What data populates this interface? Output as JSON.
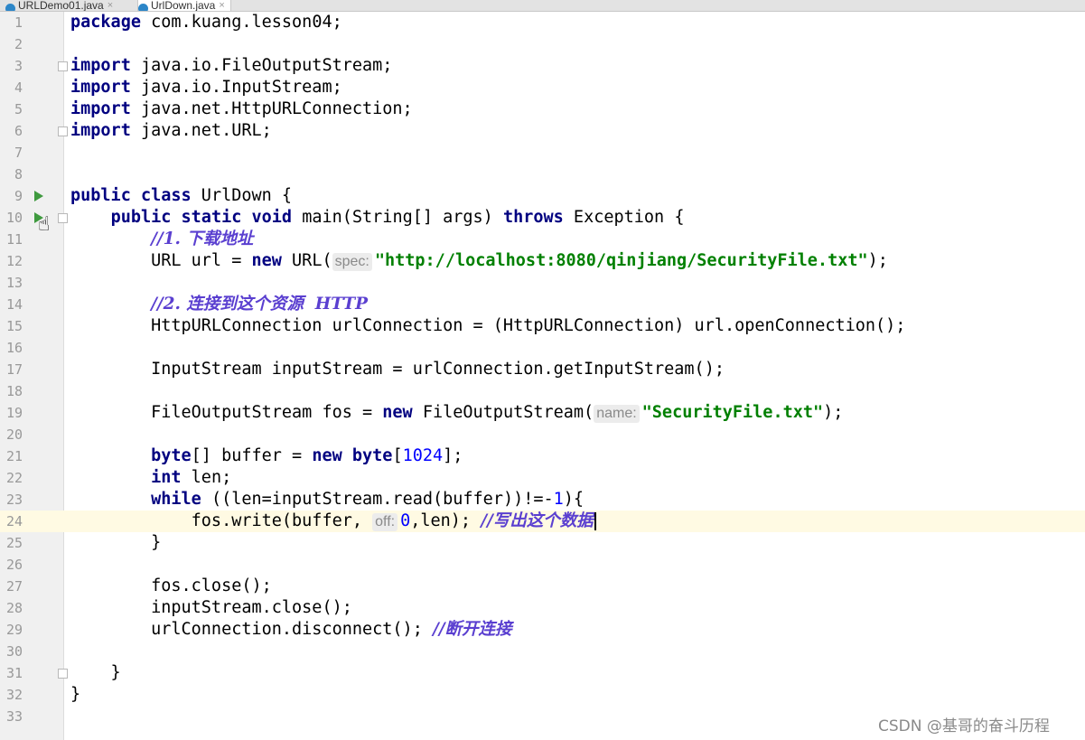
{
  "tabs": [
    {
      "label": "URLDemo01.java",
      "close": "×"
    },
    {
      "label": "UrlDown.java",
      "close": "×"
    }
  ],
  "editor": {
    "lines": [
      {
        "n": "1",
        "segs": [
          {
            "t": "package",
            "c": "kw"
          },
          {
            "t": " com.kuang.lesson04;"
          }
        ]
      },
      {
        "n": "2",
        "segs": []
      },
      {
        "n": "3",
        "fold": true,
        "segs": [
          {
            "t": "import",
            "c": "kw"
          },
          {
            "t": " java.io.FileOutputStream;"
          }
        ]
      },
      {
        "n": "4",
        "segs": [
          {
            "t": "import",
            "c": "kw"
          },
          {
            "t": " java.io.InputStream;"
          }
        ]
      },
      {
        "n": "5",
        "segs": [
          {
            "t": "import",
            "c": "kw"
          },
          {
            "t": " java.net.HttpURLConnection;"
          }
        ]
      },
      {
        "n": "6",
        "fold": true,
        "segs": [
          {
            "t": "import",
            "c": "kw"
          },
          {
            "t": " java.net.URL;"
          }
        ]
      },
      {
        "n": "7",
        "segs": []
      },
      {
        "n": "8",
        "segs": []
      },
      {
        "n": "9",
        "run": true,
        "segs": [
          {
            "t": "public",
            "c": "kw"
          },
          {
            "t": " "
          },
          {
            "t": "class",
            "c": "kw"
          },
          {
            "t": " UrlDown {"
          }
        ]
      },
      {
        "n": "10",
        "run": true,
        "fold": true,
        "segs": [
          {
            "t": "    "
          },
          {
            "t": "public",
            "c": "kw"
          },
          {
            "t": " "
          },
          {
            "t": "static",
            "c": "kw"
          },
          {
            "t": " "
          },
          {
            "t": "void",
            "c": "kw"
          },
          {
            "t": " main(String[] args) "
          },
          {
            "t": "throws",
            "c": "kw"
          },
          {
            "t": " Exception {"
          }
        ]
      },
      {
        "n": "11",
        "segs": [
          {
            "t": "        "
          },
          {
            "t": "//1. 下载地址",
            "c": "cm"
          }
        ]
      },
      {
        "n": "12",
        "segs": [
          {
            "t": "        URL url = "
          },
          {
            "t": "new",
            "c": "kw"
          },
          {
            "t": " URL("
          },
          {
            "t": "spec:",
            "c": "hint"
          },
          {
            "t": "\"http://localhost:8080/qinjiang/SecurityFile.txt\"",
            "c": "str"
          },
          {
            "t": ");"
          }
        ]
      },
      {
        "n": "13",
        "segs": []
      },
      {
        "n": "14",
        "segs": [
          {
            "t": "        "
          },
          {
            "t": "//2. 连接到这个资源  HTTP",
            "c": "cm"
          }
        ]
      },
      {
        "n": "15",
        "segs": [
          {
            "t": "        HttpURLConnection urlConnection = (HttpURLConnection) url.openConnection();"
          }
        ]
      },
      {
        "n": "16",
        "segs": []
      },
      {
        "n": "17",
        "segs": [
          {
            "t": "        InputStream inputStream = urlConnection.getInputStream();"
          }
        ]
      },
      {
        "n": "18",
        "segs": []
      },
      {
        "n": "19",
        "segs": [
          {
            "t": "        FileOutputStream fos = "
          },
          {
            "t": "new",
            "c": "kw"
          },
          {
            "t": " FileOutputStream("
          },
          {
            "t": "name:",
            "c": "hint"
          },
          {
            "t": "\"SecurityFile.txt\"",
            "c": "str"
          },
          {
            "t": ");"
          }
        ]
      },
      {
        "n": "20",
        "segs": []
      },
      {
        "n": "21",
        "segs": [
          {
            "t": "        "
          },
          {
            "t": "byte",
            "c": "kw"
          },
          {
            "t": "[] buffer = "
          },
          {
            "t": "new",
            "c": "kw"
          },
          {
            "t": " "
          },
          {
            "t": "byte",
            "c": "kw"
          },
          {
            "t": "["
          },
          {
            "t": "1024",
            "c": "num"
          },
          {
            "t": "];"
          }
        ]
      },
      {
        "n": "22",
        "segs": [
          {
            "t": "        "
          },
          {
            "t": "int",
            "c": "kw"
          },
          {
            "t": " len;"
          }
        ]
      },
      {
        "n": "23",
        "segs": [
          {
            "t": "        "
          },
          {
            "t": "while",
            "c": "kw"
          },
          {
            "t": " ((len=inputStream.read(buffer))!=-"
          },
          {
            "t": "1",
            "c": "num"
          },
          {
            "t": "){"
          }
        ]
      },
      {
        "n": "24",
        "caret": true,
        "segs": [
          {
            "t": "            fos.write(buffer, "
          },
          {
            "t": "off:",
            "c": "hint"
          },
          {
            "t": "0",
            "c": "num"
          },
          {
            "t": ",len); "
          },
          {
            "t": "//写出这个数据",
            "c": "cm"
          }
        ]
      },
      {
        "n": "25",
        "segs": [
          {
            "t": "        }"
          }
        ]
      },
      {
        "n": "26",
        "segs": []
      },
      {
        "n": "27",
        "segs": [
          {
            "t": "        fos.close();"
          }
        ]
      },
      {
        "n": "28",
        "segs": [
          {
            "t": "        inputStream.close();"
          }
        ]
      },
      {
        "n": "29",
        "segs": [
          {
            "t": "        urlConnection.disconnect(); "
          },
          {
            "t": "//断开连接",
            "c": "cm"
          }
        ]
      },
      {
        "n": "30",
        "segs": []
      },
      {
        "n": "31",
        "fold": true,
        "segs": [
          {
            "t": "    }"
          }
        ]
      },
      {
        "n": "32",
        "segs": [
          {
            "t": "}"
          }
        ]
      },
      {
        "n": "33",
        "segs": []
      }
    ]
  },
  "icons": {
    "run_gutter": "run-arrow-icon",
    "cursor": "hand-pointer-icon"
  },
  "colors": {
    "keyword": "#000080",
    "string": "#008000",
    "number": "#0000ff",
    "comment": "#5a3fd0",
    "caret_line": "#fffae3"
  },
  "watermark": "CSDN @基哥的奋斗历程"
}
